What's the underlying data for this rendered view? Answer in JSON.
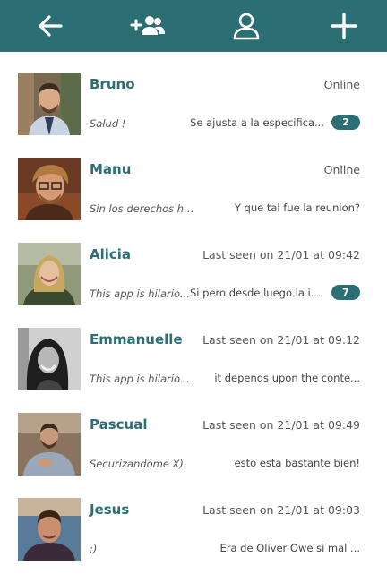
{
  "toolbar": {
    "back_icon": "arrow-left-icon",
    "group_icon": "add-group-icon",
    "profile_icon": "user-icon",
    "add_icon": "plus-icon",
    "color": "#2b6f74"
  },
  "contacts": [
    {
      "name": "Bruno",
      "status": "Online",
      "mood": "Salud !",
      "last_message": "Se ajusta a la especifica...",
      "unread": "2"
    },
    {
      "name": "Manu",
      "status": "Online",
      "mood": "Sin los derechos hu...",
      "last_message": "Y que tal fue la reunion?",
      "unread": ""
    },
    {
      "name": "Alicia",
      "status": "Last seen on 21/01 at 09:42",
      "mood": "This app is hilario...",
      "last_message": "Si pero desde luego la in...",
      "unread": "7"
    },
    {
      "name": "Emmanuelle",
      "status": "Last seen on 21/01 at 09:12",
      "mood": "This app is hilario...",
      "last_message": "it depends upon the conte...",
      "unread": ""
    },
    {
      "name": "Pascual",
      "status": "Last seen on 21/01 at 09:49",
      "mood": "Securizandome X)",
      "last_message": "esto esta bastante bien!",
      "unread": ""
    },
    {
      "name": "Jesus",
      "status": "Last seen on 21/01 at 09:03",
      "mood": ":)",
      "last_message": "Era de Oliver Owe si mal ...",
      "unread": ""
    }
  ]
}
